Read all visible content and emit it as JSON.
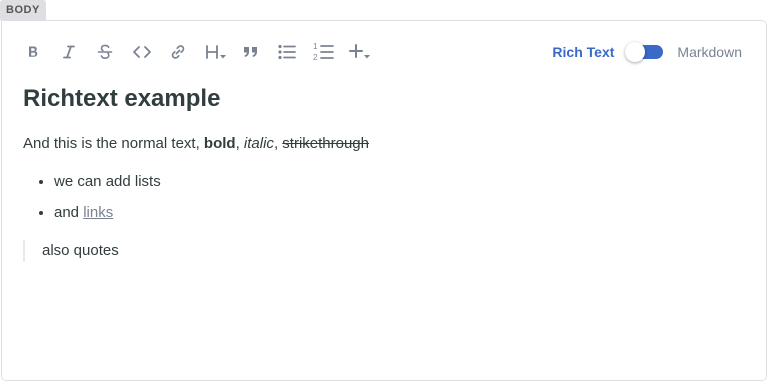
{
  "field": {
    "label": "BODY"
  },
  "toolbar": {
    "tools": [
      {
        "name": "bold-icon",
        "glyph": "B"
      },
      {
        "name": "italic-icon",
        "glyph": "I"
      },
      {
        "name": "strikethrough-icon",
        "glyph": "S"
      },
      {
        "name": "code-icon",
        "glyph": "<>"
      },
      {
        "name": "link-icon",
        "glyph": "link"
      },
      {
        "name": "heading-dropdown-icon",
        "glyph": "H"
      },
      {
        "name": "quote-icon",
        "glyph": "quote"
      },
      {
        "name": "bulleted-list-icon",
        "glyph": "ul"
      },
      {
        "name": "numbered-list-icon",
        "glyph": "ol"
      },
      {
        "name": "add-component-dropdown-icon",
        "glyph": "+"
      }
    ],
    "mode": {
      "rich_label": "Rich Text",
      "markdown_label": "Markdown",
      "active": "rich_text"
    },
    "icon_color": "#798291",
    "accent_color": "#3a69c7"
  },
  "content": {
    "heading": "Richtext example",
    "paragraph": {
      "intro": "And this is the normal text, ",
      "bold": "bold",
      "sep1": ", ",
      "italic": "italic",
      "sep2": ", ",
      "strike": "strikethrough"
    },
    "list": {
      "item1": "we can add lists",
      "item2_prefix": "and ",
      "item2_link": "links"
    },
    "quote": "also quotes"
  }
}
